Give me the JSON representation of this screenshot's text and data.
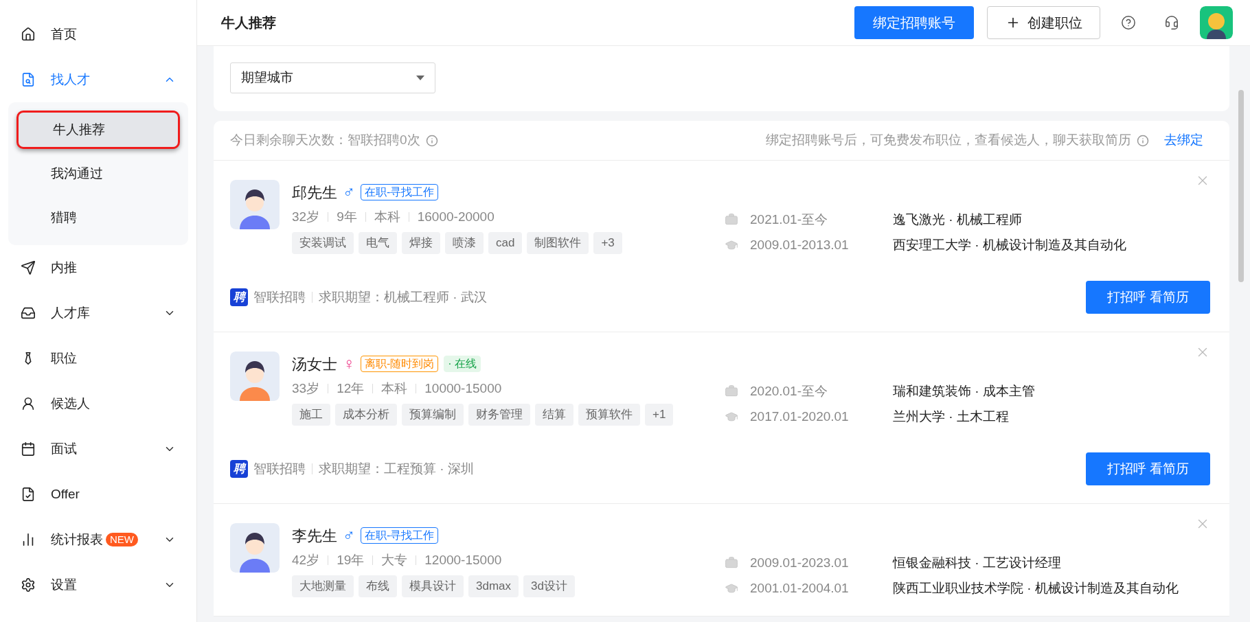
{
  "sidebar": {
    "items": [
      {
        "label": "首页",
        "active": false
      },
      {
        "label": "找人才",
        "active": true,
        "expanded": true,
        "children": [
          {
            "label": "牛人推荐",
            "selected": true
          },
          {
            "label": "我沟通过",
            "selected": false
          },
          {
            "label": "猎聘",
            "selected": false
          }
        ]
      },
      {
        "label": "内推",
        "active": false
      },
      {
        "label": "人才库",
        "active": false,
        "expanded": false
      },
      {
        "label": "职位",
        "active": false
      },
      {
        "label": "候选人",
        "active": false
      },
      {
        "label": "面试",
        "active": false,
        "expanded": false
      },
      {
        "label": "Offer",
        "active": false
      },
      {
        "label": "统计报表",
        "active": false,
        "expanded": false,
        "badge": "NEW"
      },
      {
        "label": "设置",
        "active": false,
        "expanded": false
      }
    ]
  },
  "header": {
    "title": "牛人推荐",
    "bind_button": "绑定招聘账号",
    "create_button": "创建职位"
  },
  "filter": {
    "city_select": {
      "placeholder": "期望城市"
    }
  },
  "info_bar": {
    "quota": "今日剩余聊天次数：智联招聘0次",
    "hint": "绑定招聘账号后，可免费发布职位，查看候选人，聊天获取简历",
    "link": "去绑定"
  },
  "candidates": [
    {
      "name": "邱先生",
      "kind": "male",
      "gender_symbol": "♂",
      "statuses": [
        {
          "text": "在职-寻找工作",
          "kind": "employed"
        }
      ],
      "meta": [
        "32岁",
        "9年",
        "本科",
        "16000-20000"
      ],
      "skills": [
        "安装调试",
        "电气",
        "焊接",
        "喷漆",
        "cad",
        "制图软件",
        "+3"
      ],
      "work": {
        "period": "2021.01-至今",
        "text": "逸飞激光 · 机械工程师"
      },
      "education": {
        "period": "2009.01-2013.01",
        "text": "西安理工大学 · 机械设计制造及其自动化"
      },
      "source_logo": "聘",
      "source": "智联招聘",
      "expectation": "求职期望：机械工程师 · 武汉",
      "action": "打招呼 看简历"
    },
    {
      "name": "汤女士",
      "kind": "female",
      "gender_symbol": "♀",
      "statuses": [
        {
          "text": "离职-随时到岗",
          "kind": "left"
        },
        {
          "text": "· 在线",
          "kind": "online"
        }
      ],
      "meta": [
        "33岁",
        "12年",
        "本科",
        "10000-15000"
      ],
      "skills": [
        "施工",
        "成本分析",
        "预算编制",
        "财务管理",
        "结算",
        "预算软件",
        "+1"
      ],
      "work": {
        "period": "2020.01-至今",
        "text": "瑞和建筑装饰 · 成本主管"
      },
      "education": {
        "period": "2017.01-2020.01",
        "text": "兰州大学 · 土木工程"
      },
      "source_logo": "聘",
      "source": "智联招聘",
      "expectation": "求职期望：工程预算 · 深圳",
      "action": "打招呼 看简历"
    },
    {
      "name": "李先生",
      "kind": "male",
      "gender_symbol": "♂",
      "statuses": [
        {
          "text": "在职-寻找工作",
          "kind": "employed"
        }
      ],
      "meta": [
        "42岁",
        "19年",
        "大专",
        "12000-15000"
      ],
      "skills": [
        "大地测量",
        "布线",
        "模具设计",
        "3dmax",
        "3d设计"
      ],
      "work": {
        "period": "2009.01-2023.01",
        "text": "恒银金融科技 · 工艺设计经理"
      },
      "education": {
        "period": "2001.01-2004.01",
        "text": "陕西工业职业技术学院 · 机械设计制造及其自动化"
      }
    }
  ]
}
